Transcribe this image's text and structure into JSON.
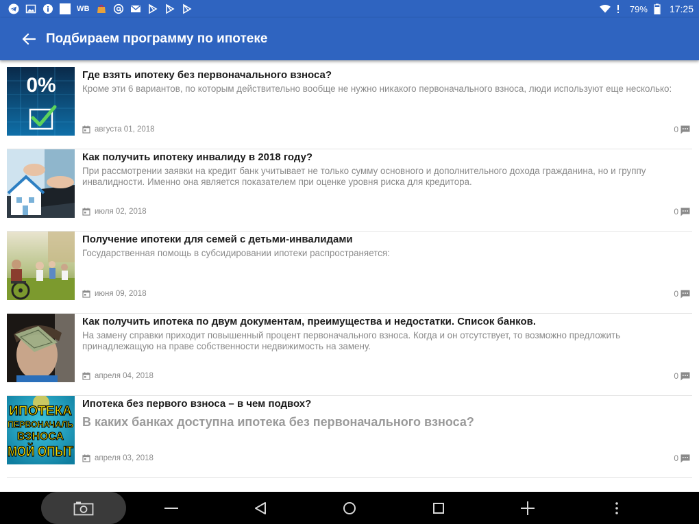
{
  "status_bar": {
    "wb_label": "WB",
    "battery": "79%",
    "time": "17:25"
  },
  "app_bar": {
    "title": "Подбираем программу по ипотеке"
  },
  "articles": [
    {
      "title": "Где взять ипотеку без первоначального взноса?",
      "description": "Кроме эти 6 вариантов, по которым действительно вообще не нужно никакого первоначального взноса, люди используют еще несколько:",
      "date": "августа 01, 2018",
      "comments": "0",
      "thumb_text": "0%"
    },
    {
      "title": "Как получить ипотеку инвалиду в 2018 году?",
      "description": "При рассмотрении заявки на кредит банк учитывает не только сумму основного и дополнительного дохода гражданина, но и группу инвалидности. Именно она является показателем при оценке уровня риска для кредитора.",
      "date": "июля 02, 2018",
      "comments": "0"
    },
    {
      "title": "Получение ипотеки для семей с детьми-инвалидами",
      "description": "Государственная помощь в субсидировании ипотеки распространяется:",
      "date": "июня 09, 2018",
      "comments": "0"
    },
    {
      "title": "Как получить ипотека по двум документам, преимущества и недостатки. Список банков.",
      "description": "На замену справки приходит повышенный процент первоначального взноса. Когда и он отсутствует, то возможно предложить принадлежащую на праве собственности недвижимость на замену.",
      "date": "апреля 04, 2018",
      "comments": "0"
    },
    {
      "title": "Ипотека без первого взноса – в чем подвох?",
      "description": "В каких банках доступна ипотека без первоначального взноса?",
      "date": "апреля 03, 2018",
      "comments": "0",
      "thumb_lines": [
        "ИПОТЕКА",
        "ПЕРВОНАЧАЛЬ",
        "ВЗНОСА",
        "МОЙ ОПЫТ"
      ]
    }
  ],
  "icons": {
    "back": "arrow-left-icon",
    "date": "calendar-icon",
    "comments": "comment-icon"
  },
  "colors": {
    "primary": "#2f64c0",
    "title_text": "#1c1c1c",
    "secondary_text": "#8a8a8a"
  }
}
